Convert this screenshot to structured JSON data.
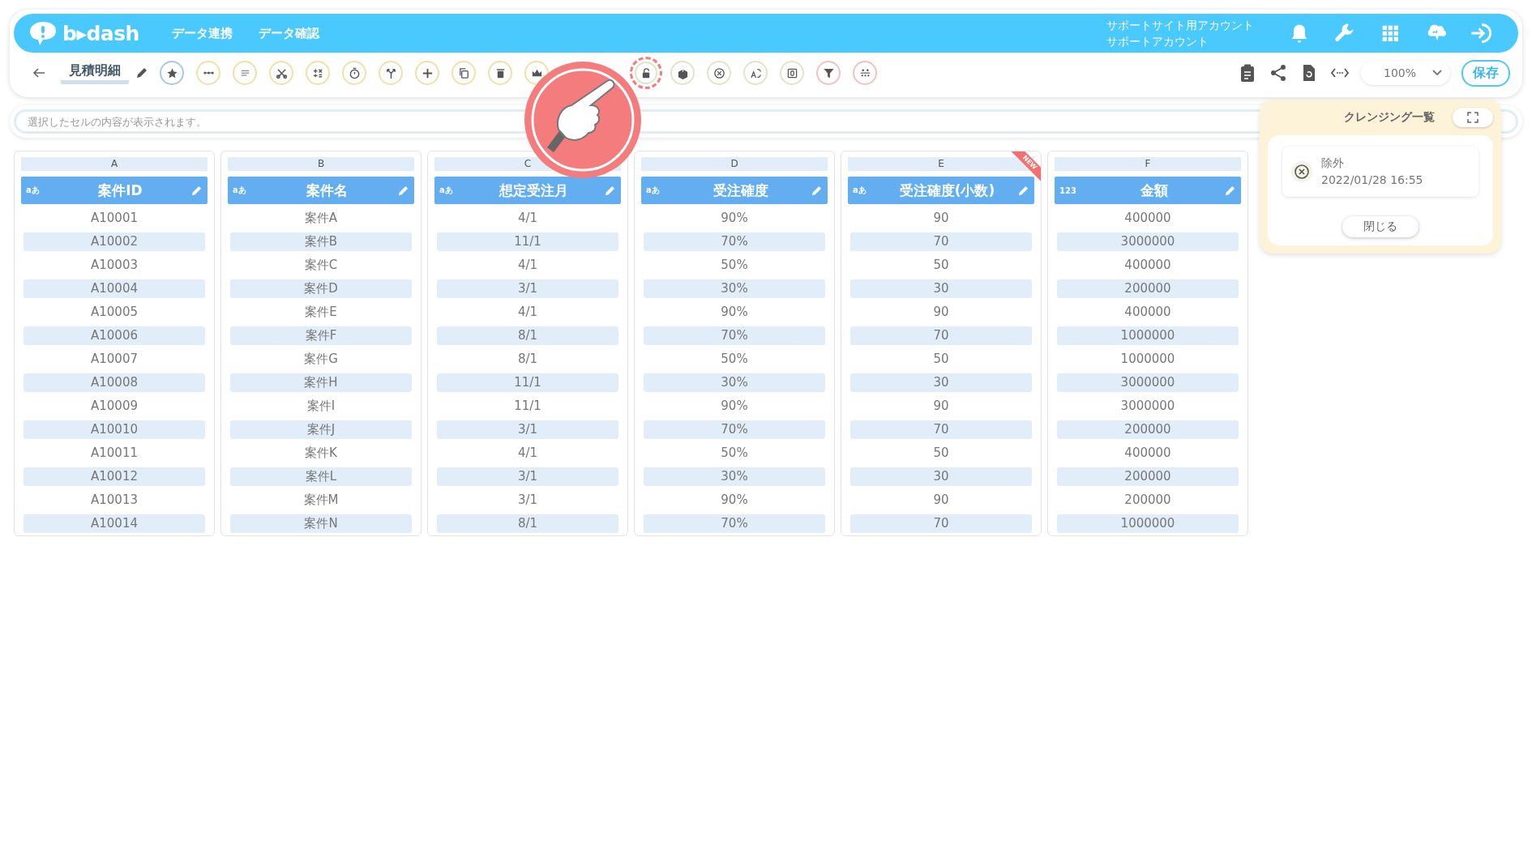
{
  "header": {
    "logo": "b▸dash",
    "nav": [
      "データ連携",
      "データ確認"
    ],
    "account": [
      "サポートサイト用アカウント",
      "サポートアカウント"
    ]
  },
  "toolbar": {
    "title": "見積明細",
    "icons": [
      {
        "kind": "star",
        "color": "#a9c8e8",
        "highlighted": false
      },
      {
        "kind": "dots",
        "color": "#f3e0a8",
        "highlighted": false
      },
      {
        "kind": "lines",
        "color": "#f3e0a8",
        "highlighted": false
      },
      {
        "kind": "scissors",
        "color": "#f3e0a8",
        "highlighted": false
      },
      {
        "kind": "calc",
        "color": "#f3e0a8",
        "highlighted": false
      },
      {
        "kind": "timer",
        "color": "#f3e0a8",
        "highlighted": false
      },
      {
        "kind": "branch",
        "color": "#f3e0a8",
        "highlighted": false
      },
      {
        "kind": "plus",
        "color": "#f3e0a8",
        "highlighted": false
      },
      {
        "kind": "copy",
        "color": "#f3e0a8",
        "highlighted": false
      },
      {
        "kind": "trash",
        "color": "#f3e0a8",
        "highlighted": false
      },
      {
        "kind": "crown",
        "color": "#f3e0a8",
        "highlighted": false
      },
      {
        "kind": "lock",
        "color": "#dfe6c8",
        "highlighted": true
      },
      {
        "kind": "box",
        "color": "#dfe6c8",
        "highlighted": false
      },
      {
        "kind": "close",
        "color": "#dfe6c8",
        "highlighted": false
      },
      {
        "kind": "translate",
        "color": "#dfe6c8",
        "highlighted": false
      },
      {
        "kind": "zero",
        "color": "#dfe6c8",
        "highlighted": false
      },
      {
        "kind": "filter",
        "color": "#f4c0c0",
        "highlighted": false
      },
      {
        "kind": "group",
        "color": "#f4c0c0",
        "highlighted": false
      }
    ],
    "zoom": "100%",
    "save": "保存"
  },
  "cell_bar": {
    "placeholder": "選択したセルの内容が表示されます。"
  },
  "table": {
    "columns": [
      {
        "letter": "A",
        "type_label": "aあ",
        "name": "案件ID"
      },
      {
        "letter": "B",
        "type_label": "aあ",
        "name": "案件名"
      },
      {
        "letter": "C",
        "type_label": "aあ",
        "name": "想定受注月"
      },
      {
        "letter": "D",
        "type_label": "aあ",
        "name": "受注確度"
      },
      {
        "letter": "E",
        "type_label": "aあ",
        "name": "受注確度(小数)",
        "badge": "NEW"
      },
      {
        "letter": "F",
        "type_label": "123",
        "name": "金額"
      }
    ],
    "rows": [
      [
        "A10001",
        "案件A",
        "4/1",
        "90%",
        "90",
        "400000"
      ],
      [
        "A10002",
        "案件B",
        "11/1",
        "70%",
        "70",
        "3000000"
      ],
      [
        "A10003",
        "案件C",
        "4/1",
        "50%",
        "50",
        "400000"
      ],
      [
        "A10004",
        "案件D",
        "3/1",
        "30%",
        "30",
        "200000"
      ],
      [
        "A10005",
        "案件E",
        "4/1",
        "90%",
        "90",
        "400000"
      ],
      [
        "A10006",
        "案件F",
        "8/1",
        "70%",
        "70",
        "1000000"
      ],
      [
        "A10007",
        "案件G",
        "8/1",
        "50%",
        "50",
        "1000000"
      ],
      [
        "A10008",
        "案件H",
        "11/1",
        "30%",
        "30",
        "3000000"
      ],
      [
        "A10009",
        "案件I",
        "11/1",
        "90%",
        "90",
        "3000000"
      ],
      [
        "A10010",
        "案件J",
        "3/1",
        "70%",
        "70",
        "200000"
      ],
      [
        "A10011",
        "案件K",
        "4/1",
        "50%",
        "50",
        "400000"
      ],
      [
        "A10012",
        "案件L",
        "3/1",
        "30%",
        "30",
        "200000"
      ],
      [
        "A10013",
        "案件M",
        "3/1",
        "90%",
        "90",
        "200000"
      ],
      [
        "A10014",
        "案件N",
        "8/1",
        "70%",
        "70",
        "1000000"
      ]
    ]
  },
  "cleansing_panel": {
    "title": "クレンジング一覧",
    "items": [
      {
        "label": "除外",
        "time": "2022/01/28 16:55"
      }
    ],
    "close": "閉じる"
  }
}
